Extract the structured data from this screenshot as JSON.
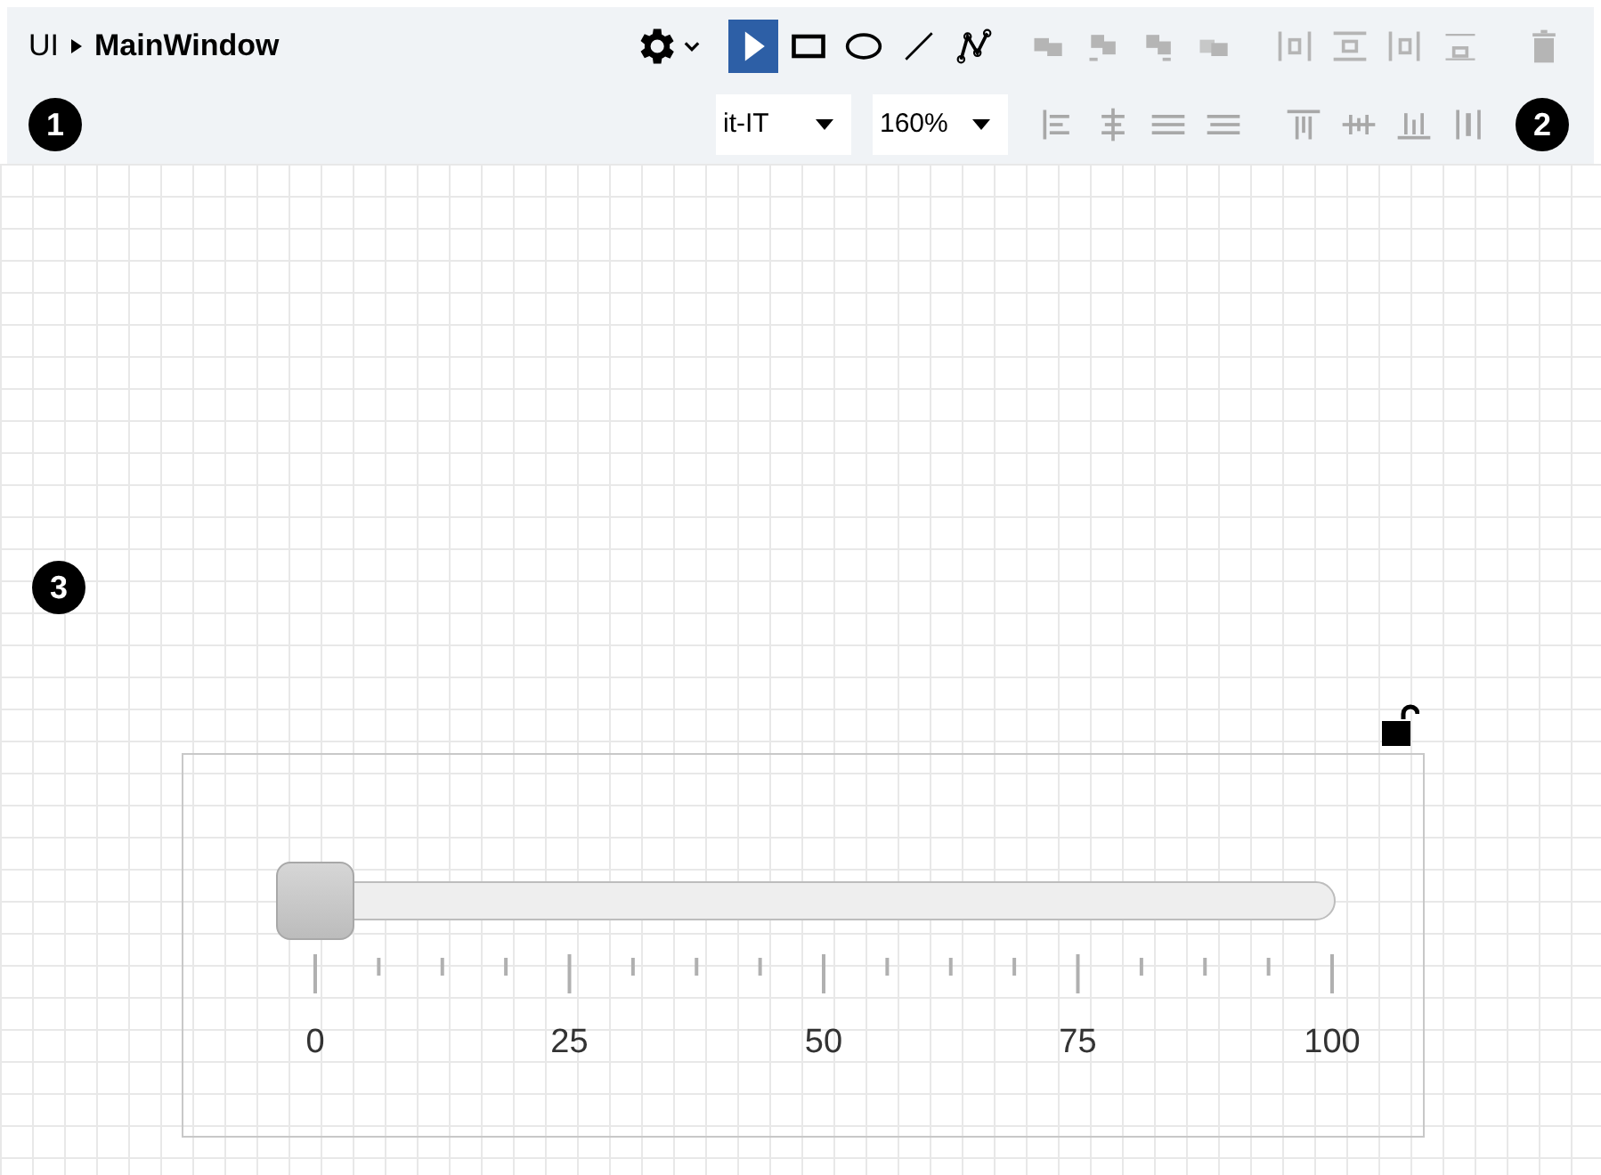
{
  "breadcrumb": {
    "root": "UI",
    "current": "MainWindow"
  },
  "callouts": [
    "1",
    "2",
    "3"
  ],
  "draw_tools": [
    {
      "kind": "select",
      "selected": true
    },
    {
      "kind": "rectangle",
      "selected": false
    },
    {
      "kind": "ellipse",
      "selected": false
    },
    {
      "kind": "line",
      "selected": false
    },
    {
      "kind": "polyline",
      "selected": false
    }
  ],
  "arrange_tools": [
    {
      "kind": "bring-front",
      "disabled": true
    },
    {
      "kind": "bring-forward",
      "disabled": true
    },
    {
      "kind": "send-backward",
      "disabled": true
    },
    {
      "kind": "send-back",
      "disabled": true
    },
    {
      "kind": "distribute-h",
      "disabled": true
    },
    {
      "kind": "distribute-top",
      "disabled": true
    },
    {
      "kind": "distribute-right",
      "disabled": true
    },
    {
      "kind": "distribute-bottom",
      "disabled": true
    },
    {
      "kind": "delete",
      "disabled": true
    }
  ],
  "locale": {
    "value": "it-IT"
  },
  "zoom": {
    "value": "160%"
  },
  "align_tools": [
    {
      "kind": "align-left",
      "disabled": false
    },
    {
      "kind": "align-center",
      "disabled": false
    },
    {
      "kind": "align-justify",
      "disabled": false
    },
    {
      "kind": "align-right",
      "disabled": false
    },
    {
      "kind": "valign-top",
      "disabled": false
    },
    {
      "kind": "valign-middle",
      "disabled": false
    },
    {
      "kind": "valign-bottom",
      "disabled": false
    },
    {
      "kind": "valign-stretch",
      "disabled": false
    }
  ],
  "widget": {
    "locked": false,
    "slider": {
      "level": 0,
      "tick_labels": [
        "0",
        "25",
        "50",
        "75",
        "100"
      ]
    }
  }
}
